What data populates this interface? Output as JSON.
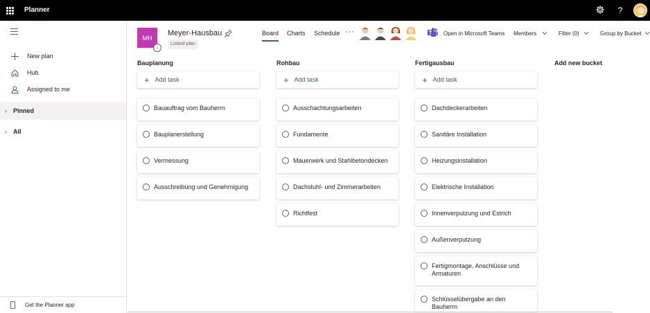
{
  "app": {
    "title": "Planner"
  },
  "leftnav": {
    "items": [
      {
        "label": "New plan",
        "icon": "plus-icon"
      },
      {
        "label": "Hub",
        "icon": "home-icon"
      },
      {
        "label": "Assigned to me",
        "icon": "person-icon"
      }
    ],
    "sections": [
      {
        "label": "Pinned"
      },
      {
        "label": "All"
      }
    ],
    "get_app": "Get the Planner app"
  },
  "plan": {
    "initials": "MH",
    "name": "Meyer-Hausbau",
    "linked": "Linked plan",
    "info": "i",
    "badge_color": "#c239b3"
  },
  "tabs": [
    {
      "label": "Board",
      "active": true
    },
    {
      "label": "Charts",
      "active": false
    },
    {
      "label": "Schedule",
      "active": false
    }
  ],
  "header": {
    "more": "···",
    "teams": "Open in Microsoft Teams",
    "members": "Members",
    "filter": "Filter (0)",
    "group": "Group by Bucket"
  },
  "add_task_label": "Add task",
  "add_bucket_label": "Add new bucket",
  "buckets": [
    {
      "title": "Bauplanung",
      "tasks": [
        "Bauauftrag vom Bauherrn",
        "Bauplanerstellung",
        "Vermessung",
        "Ausschreibung und Genehmigung"
      ]
    },
    {
      "title": "Rohbau",
      "tasks": [
        "Ausschachtungsarbeiten",
        "Fundamente",
        "Mauerwerk und Stahlbetondecken",
        "Dachstuhl- und Zimmerarbeiten",
        "Richtfest"
      ]
    },
    {
      "title": "Fertigausbau",
      "tasks": [
        "Dachdeckerarbeiten",
        "Sanitäre Installation",
        "Heizungsinstallation",
        "Elektrische Installation",
        "Innenverputzung und Estrich",
        "Außenverputzung",
        "Fertigmontage, Anschlüsse und Armaturen",
        "Schlüsselübergabe an den Bauherrn"
      ]
    }
  ],
  "colors": {
    "accent": "#31752f",
    "topbar": "#000000"
  }
}
